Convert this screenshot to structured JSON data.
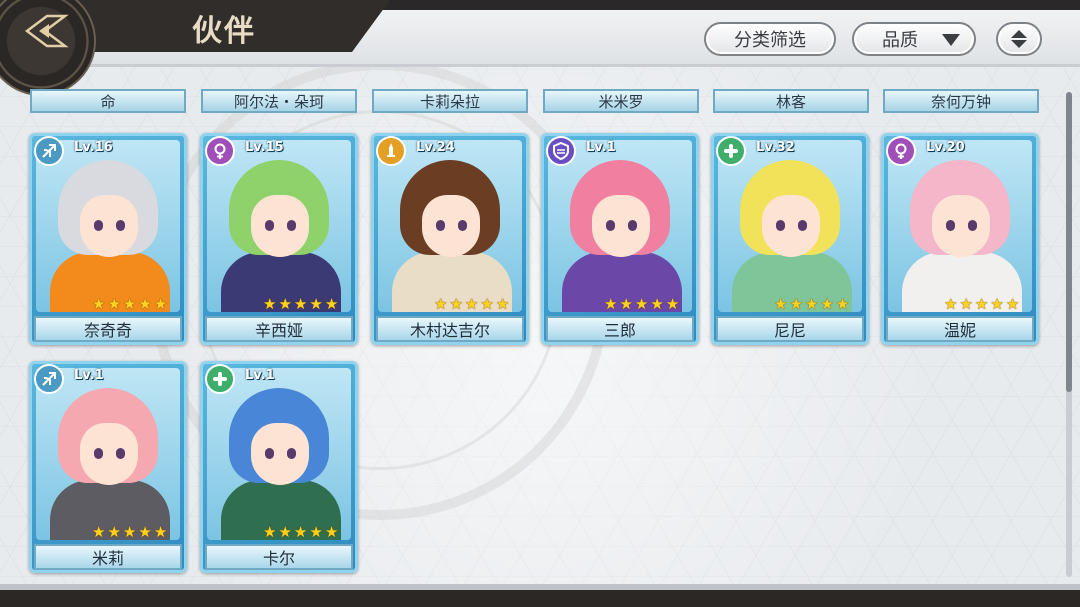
{
  "header": {
    "title": "伙伴",
    "filter_label": "分类筛选",
    "quality_label": "品质"
  },
  "tabs": [
    "命",
    "阿尔法・朵珂",
    "卡莉朵拉",
    "米米罗",
    "林客",
    "奈何万钟"
  ],
  "partners": [
    {
      "name": "奈奇奇",
      "level": "Lv.16",
      "stars": 5,
      "class_icon": "bow-icon",
      "class_color": "#4a9ac4",
      "hair": "#d9d9e0",
      "outfit": "#f28a1c"
    },
    {
      "name": "辛西娅",
      "level": "Lv.15",
      "stars": 5,
      "class_icon": "venus-icon",
      "class_color": "#a14fb8",
      "hair": "#8fd16a",
      "outfit": "#3c3a74"
    },
    {
      "name": "木村达吉尔",
      "level": "Lv.24",
      "stars": 5,
      "class_icon": "sword-icon",
      "class_color": "#e3a024",
      "hair": "#6b3d22",
      "outfit": "#e9ddc8"
    },
    {
      "name": "三郎",
      "level": "Lv.1",
      "stars": 5,
      "class_icon": "shield-icon",
      "class_color": "#6a4fc4",
      "hair": "#f07fa0",
      "outfit": "#6b47a8"
    },
    {
      "name": "尼尼",
      "level": "Lv.32",
      "stars": 5,
      "class_icon": "clover-icon",
      "class_color": "#3fae6a",
      "hair": "#f2e25a",
      "outfit": "#7fc59a"
    },
    {
      "name": "温妮",
      "level": "Lv.20",
      "stars": 5,
      "class_icon": "venus-icon",
      "class_color": "#a14fb8",
      "hair": "#f4b6c8",
      "outfit": "#f2f0ef"
    },
    {
      "name": "米莉",
      "level": "Lv.1",
      "stars": 5,
      "class_icon": "bow-icon",
      "class_color": "#4a9ac4",
      "hair": "#f6a8b0",
      "outfit": "#5c5c62"
    },
    {
      "name": "卡尔",
      "level": "Lv.1",
      "stars": 5,
      "class_icon": "clover-icon",
      "class_color": "#3fae6a",
      "hair": "#4a86d8",
      "outfit": "#2f6e4e"
    }
  ]
}
